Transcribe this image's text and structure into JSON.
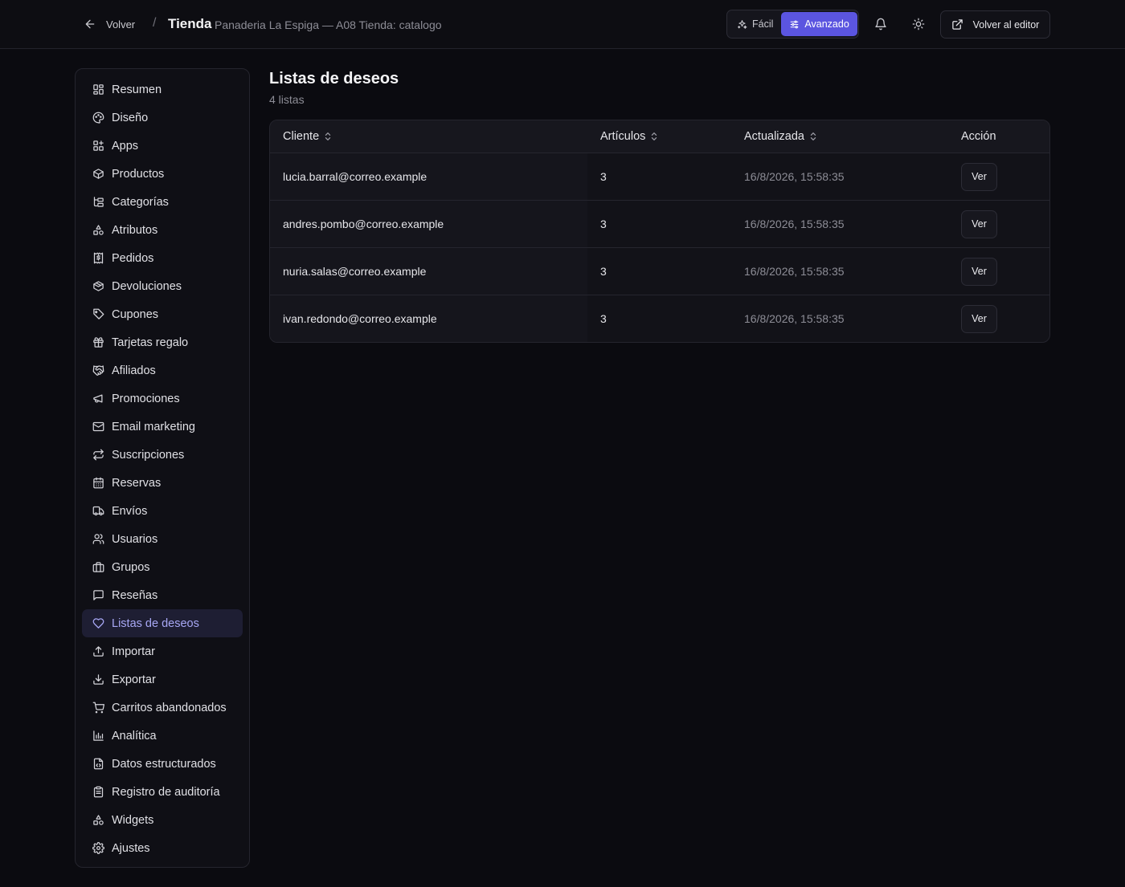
{
  "header": {
    "back_label": "Volver",
    "separator": "/",
    "title": "Tienda",
    "subtitle": "Panaderia La Espiga — A08 Tienda: catalogo",
    "mode_easy": "Fácil",
    "mode_advanced": "Avanzado",
    "active_mode": "Avanzado",
    "editor_label": "Volver al editor"
  },
  "sidebar": {
    "items": [
      {
        "label": "Resumen",
        "icon": "grid-icon"
      },
      {
        "label": "Diseño",
        "icon": "palette-icon"
      },
      {
        "label": "Apps",
        "icon": "apps-icon"
      },
      {
        "label": "Productos",
        "icon": "box-icon"
      },
      {
        "label": "Categorías",
        "icon": "tree-icon"
      },
      {
        "label": "Atributos",
        "icon": "shapes-icon"
      },
      {
        "label": "Pedidos",
        "icon": "receipt-icon"
      },
      {
        "label": "Devoluciones",
        "icon": "box-return-icon"
      },
      {
        "label": "Cupones",
        "icon": "tag-icon"
      },
      {
        "label": "Tarjetas regalo",
        "icon": "gift-icon"
      },
      {
        "label": "Afiliados",
        "icon": "handshake-icon"
      },
      {
        "label": "Promociones",
        "icon": "megaphone-icon"
      },
      {
        "label": "Email marketing",
        "icon": "mail-icon"
      },
      {
        "label": "Suscripciones",
        "icon": "repeat-icon"
      },
      {
        "label": "Reservas",
        "icon": "calendar-icon"
      },
      {
        "label": "Envíos",
        "icon": "truck-icon"
      },
      {
        "label": "Usuarios",
        "icon": "users-icon"
      },
      {
        "label": "Grupos",
        "icon": "briefcase-icon"
      },
      {
        "label": "Reseñas",
        "icon": "message-icon"
      },
      {
        "label": "Listas de deseos",
        "icon": "heart-icon"
      },
      {
        "label": "Importar",
        "icon": "upload-icon"
      },
      {
        "label": "Exportar",
        "icon": "download-icon"
      },
      {
        "label": "Carritos abandonados",
        "icon": "cart-icon"
      },
      {
        "label": "Analítica",
        "icon": "chart-icon"
      },
      {
        "label": "Datos estructurados",
        "icon": "file-code-icon"
      },
      {
        "label": "Registro de auditoría",
        "icon": "clipboard-icon"
      },
      {
        "label": "Widgets",
        "icon": "shapes-icon"
      },
      {
        "label": "Ajustes",
        "icon": "gear-icon"
      }
    ],
    "active_item": "Listas de deseos"
  },
  "main": {
    "title": "Listas de deseos",
    "count_text": "4 listas",
    "table": {
      "headers": [
        "Cliente",
        "Artículos",
        "Actualizada",
        "Acción"
      ],
      "rows": [
        {
          "cliente": "lucia.barral@correo.example",
          "articulos": "3",
          "actualizada": "16/8/2026, 15:58:35",
          "accion": "Ver"
        },
        {
          "cliente": "andres.pombo@correo.example",
          "articulos": "3",
          "actualizada": "16/8/2026, 15:58:35",
          "accion": "Ver"
        },
        {
          "cliente": "nuria.salas@correo.example",
          "articulos": "3",
          "actualizada": "16/8/2026, 15:58:35",
          "accion": "Ver"
        },
        {
          "cliente": "ivan.redondo@correo.example",
          "articulos": "3",
          "actualizada": "16/8/2026, 15:58:35",
          "accion": "Ver"
        }
      ]
    }
  },
  "colors": {
    "background": "#0b0b10",
    "accent": "#5b55e0",
    "active_nav_text": "#a8a8f5"
  }
}
